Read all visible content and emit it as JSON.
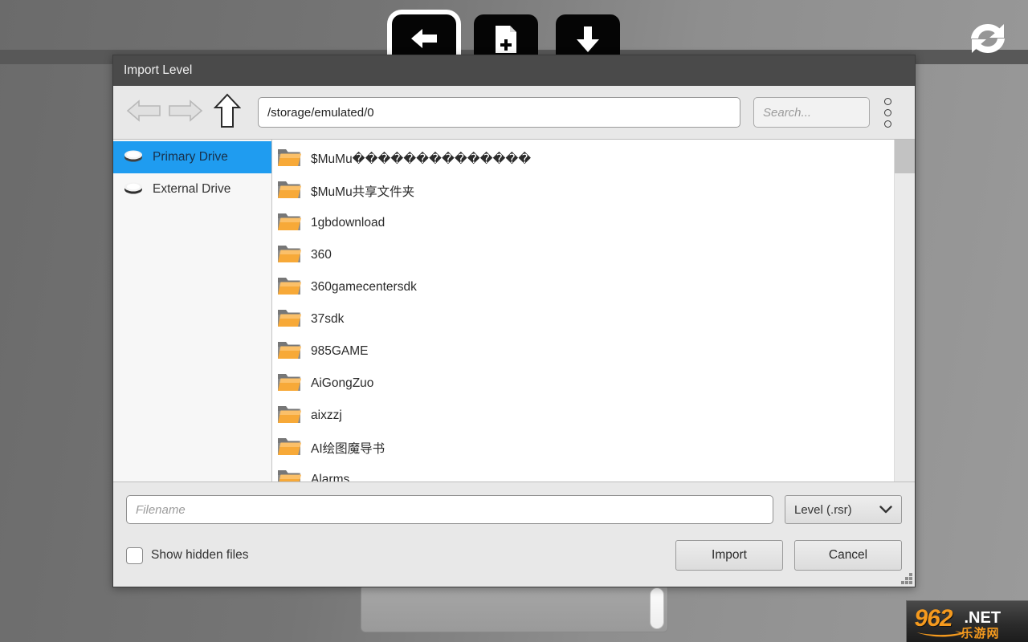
{
  "background": {
    "toolbar_buttons": [
      {
        "name": "undo-button",
        "icon": "undo-arrow-icon",
        "selected": true
      },
      {
        "name": "new-file-button",
        "icon": "new-file-plus-icon",
        "selected": false
      },
      {
        "name": "download-button",
        "icon": "download-arrow-icon",
        "selected": false
      }
    ],
    "refresh_icon": "refresh-sync-icon"
  },
  "watermark": {
    "number": "962",
    "tld": ".NET",
    "cn": "乐游网"
  },
  "dialog": {
    "title": "Import Level",
    "toolbar": {
      "back_icon": "back-arrow-icon",
      "forward_icon": "forward-arrow-icon",
      "up_icon": "up-arrow-icon",
      "path_value": "/storage/emulated/0",
      "search_placeholder": "Search...",
      "menu_icon": "overflow-menu-icon"
    },
    "places": {
      "items": [
        {
          "label": "Primary Drive",
          "icon": "drive-icon",
          "active": true
        },
        {
          "label": "External Drive",
          "icon": "drive-icon",
          "active": false
        }
      ]
    },
    "files": {
      "icon": "folder-icon",
      "items": [
        {
          "name": "$MuMu��������������",
          "type": "folder"
        },
        {
          "name": "$MuMu共享文件夹",
          "type": "folder"
        },
        {
          "name": "1gbdownload",
          "type": "folder"
        },
        {
          "name": "360",
          "type": "folder"
        },
        {
          "name": "360gamecentersdk",
          "type": "folder"
        },
        {
          "name": "37sdk",
          "type": "folder"
        },
        {
          "name": "985GAME",
          "type": "folder"
        },
        {
          "name": "AiGongZuo",
          "type": "folder"
        },
        {
          "name": "aixzzj",
          "type": "folder"
        },
        {
          "name": "AI绘图魔导书",
          "type": "folder"
        },
        {
          "name": "Alarms",
          "type": "folder"
        }
      ]
    },
    "footer": {
      "filename_placeholder": "Filename",
      "filetype_value": "Level (.rsr)",
      "filetype_chevron": "chevron-down-icon",
      "show_hidden_label": "Show hidden files",
      "show_hidden_checked": false,
      "import_label": "Import",
      "cancel_label": "Cancel",
      "resize_grip": "resize-grip-icon"
    }
  },
  "colors": {
    "titlebar": "#4a4a4a",
    "chrome": "#e8e8e8",
    "selection": "#1f9cf0",
    "folder": "#f5a623",
    "watermark_orange": "#f59a1e"
  }
}
